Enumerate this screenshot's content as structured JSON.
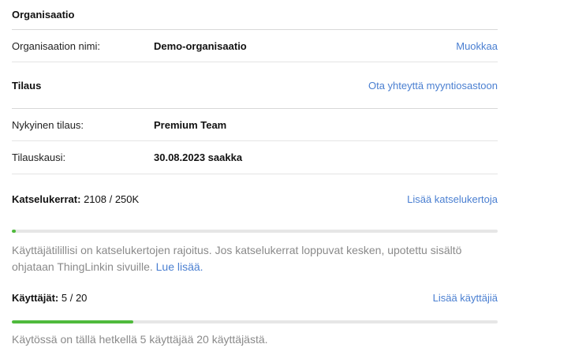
{
  "organisation": {
    "title": "Organisaatio",
    "name_label": "Organisaation nimi:",
    "name_value": "Demo-organisaatio",
    "edit_link": "Muokkaa"
  },
  "subscription": {
    "title": "Tilaus",
    "contact_link": "Ota yhteyttä myyntiosastoon",
    "current_label": "Nykyinen tilaus:",
    "current_value": "Premium Team",
    "period_label": "Tilauskausi:",
    "period_value": "30.08.2023 saakka"
  },
  "views": {
    "label": "Katselukerrat:",
    "value": "2108 / 250K",
    "fraction": 0.008432,
    "add_link": "Lisää katselukertoja",
    "note_text": "Käyttäjätilillisi on katselukertojen rajoitus. Jos katselukerrat loppuvat kesken, upotettu sisältö ohjataan ThingLinkin sivuille.",
    "note_link": "Lue lisää."
  },
  "users": {
    "label": "Käyttäjät:",
    "value": "5 / 20",
    "fraction": 0.25,
    "add_link": "Lisää käyttäjiä",
    "note_text": "Käytössä on tällä hetkellä 5 käyttäjää 20 käyttäjästä."
  },
  "colors": {
    "progress": "#4fba3c",
    "link": "#4a7fd1"
  }
}
